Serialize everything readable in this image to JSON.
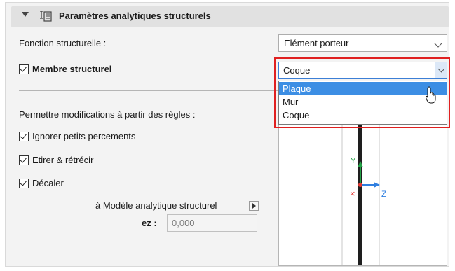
{
  "section": {
    "title": "Paramètres analytiques structurels"
  },
  "fonction": {
    "label": "Fonction structurelle :",
    "value": "Elément porteur"
  },
  "membre": {
    "label": "Membre structurel",
    "checked": true,
    "value": "Coque",
    "options": [
      "Plaque",
      "Mur",
      "Coque"
    ],
    "highlighted": "Plaque"
  },
  "rules": {
    "label": "Permettre modifications à partir des règles :"
  },
  "checks": {
    "ignorer": "Ignorer petits percements",
    "etirer": "Etirer & rétrécir",
    "decaler": "Décaler"
  },
  "model": {
    "label": "à Modèle analytique structurel"
  },
  "ez": {
    "label": "ez :",
    "value": "0,000"
  },
  "axes": {
    "y": "Y",
    "z": "Z",
    "x": "×"
  },
  "colors": {
    "highlight": "#3c8ee4",
    "red_outline": "#e02020",
    "axis_y": "#22a045",
    "axis_z": "#2f7fe0",
    "axis_x": "#e53935"
  }
}
